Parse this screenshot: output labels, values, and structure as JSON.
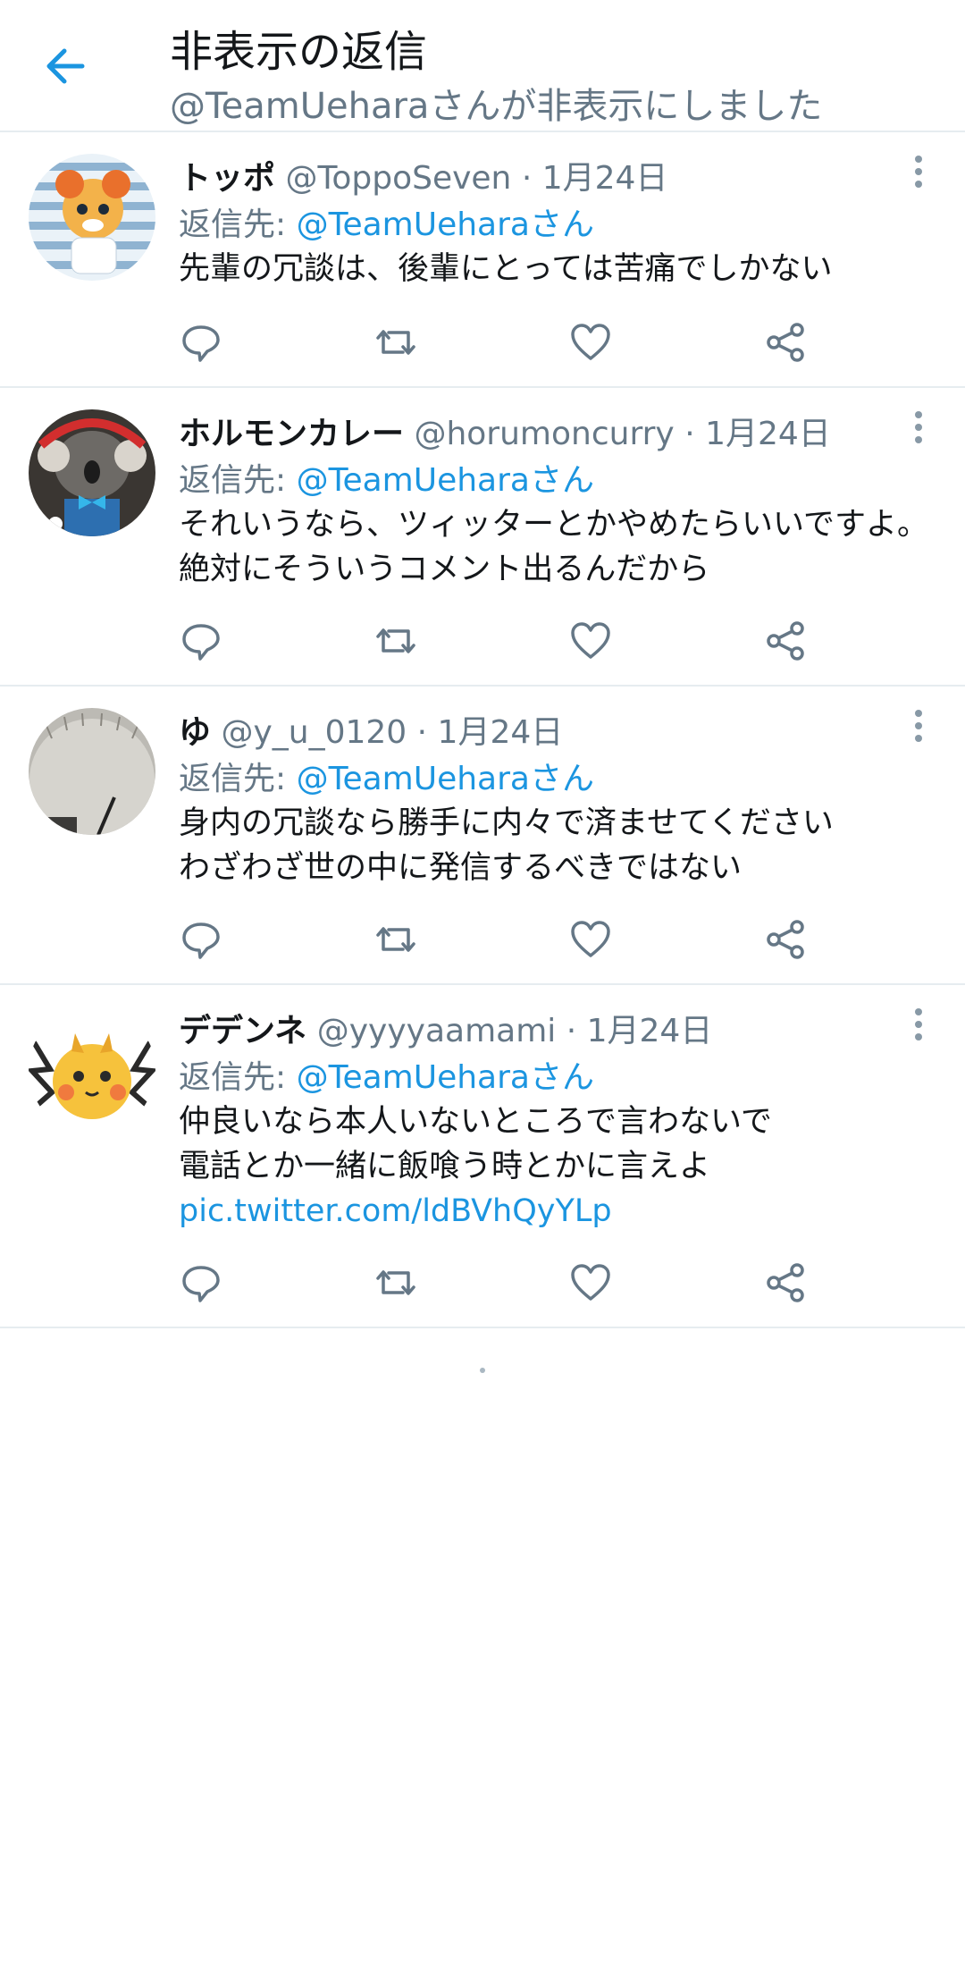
{
  "header": {
    "title": "非表示の返信",
    "subtitle": "@TeamUeharaさんが非表示にしました"
  },
  "colors": {
    "accent": "#1b95e0",
    "muted": "#657786",
    "text": "#14171a",
    "divider": "#e6ecf0"
  },
  "reply_prefix": "返信先:",
  "tweets": [
    {
      "name": "トッポ",
      "handle": "@ToppoSeven",
      "date": "· 1月24日",
      "reply_to": "@TeamUeharaさん",
      "lines": [
        "先輩の冗談は、後輩にとっては苦痛でしかない"
      ],
      "link": ""
    },
    {
      "name": "ホルモンカレー",
      "handle": "@horumoncurry",
      "date": "· 1月24日",
      "reply_to": "@TeamUeharaさん",
      "lines": [
        "それいうなら、ツィッターとかやめたらいいですよ。",
        "絶対にそういうコメント出るんだから"
      ],
      "link": ""
    },
    {
      "name": "ゆ",
      "handle": "@y_u_0120",
      "date": "· 1月24日",
      "reply_to": "@TeamUeharaさん",
      "lines": [
        "身内の冗談なら勝手に内々で済ませてください",
        "わざわざ世の中に発信するべきではない"
      ],
      "link": ""
    },
    {
      "name": "デデンネ",
      "handle": "@yyyyaamami",
      "date": "· 1月24日",
      "reply_to": "@TeamUeharaさん",
      "lines": [
        "仲良いなら本人いないところで言わないで",
        "電話とか一緒に飯喰う時とかに言えよ"
      ],
      "link": "pic.twitter.com/ldBVhQyYLp"
    }
  ],
  "icons": {
    "back": "arrow-left-icon",
    "reply": "reply-bubble-icon",
    "retweet": "retweet-icon",
    "like": "heart-icon",
    "share": "share-icon",
    "more": "more-vertical-icon"
  }
}
